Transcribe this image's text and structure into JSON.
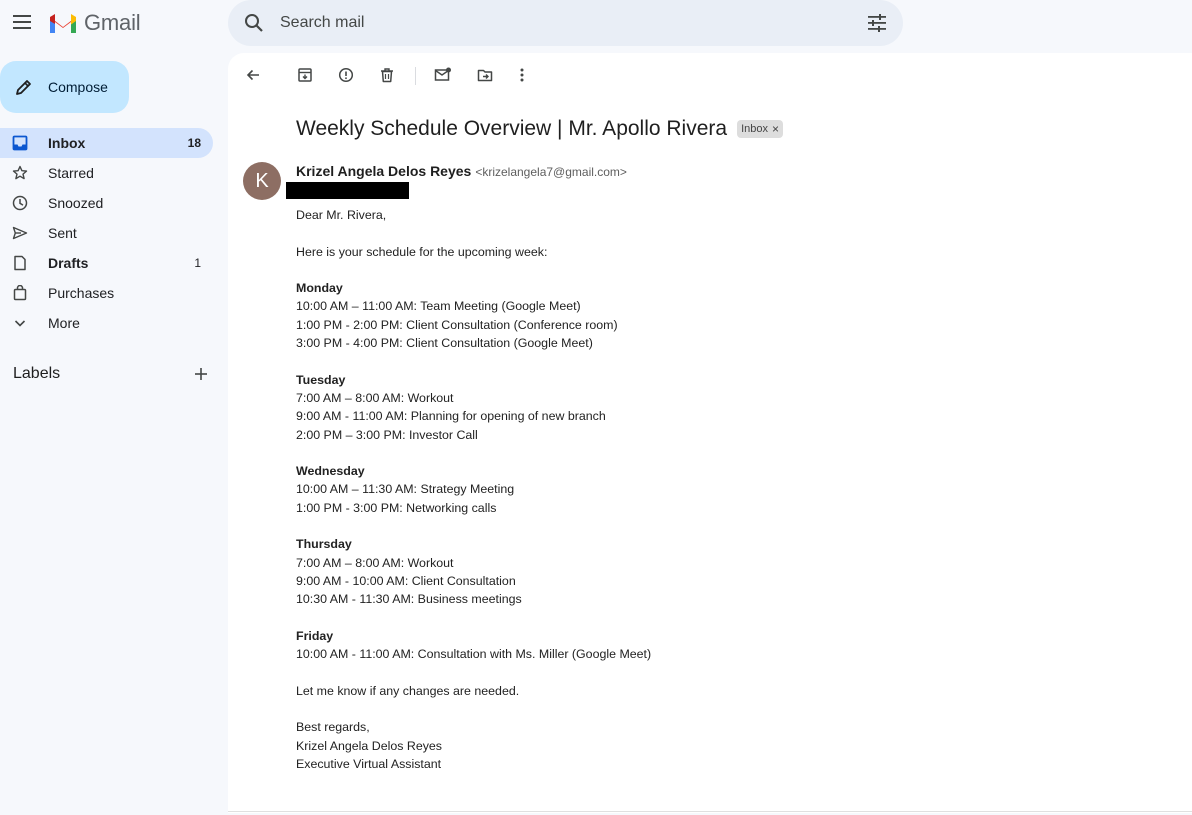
{
  "app": {
    "name": "Gmail"
  },
  "search": {
    "placeholder": "Search mail"
  },
  "compose": {
    "label": "Compose"
  },
  "nav": {
    "items": [
      {
        "label": "Inbox",
        "count": "18"
      },
      {
        "label": "Starred",
        "count": ""
      },
      {
        "label": "Snoozed",
        "count": ""
      },
      {
        "label": "Sent",
        "count": ""
      },
      {
        "label": "Drafts",
        "count": "1"
      },
      {
        "label": "Purchases",
        "count": ""
      },
      {
        "label": "More",
        "count": ""
      }
    ]
  },
  "labels": {
    "title": "Labels"
  },
  "email": {
    "subject": "Weekly Schedule Overview | Mr. Apollo Rivera",
    "label_chip": "Inbox",
    "chip_close": "×",
    "avatar_letter": "K",
    "sender_name": "Krizel Angela Delos Reyes",
    "sender_email": "<krizelangela7@gmail.com>",
    "greeting": "Dear Mr. Rivera,",
    "intro": "Here is your schedule for the upcoming week:",
    "days": [
      {
        "name": "Monday",
        "items": [
          "10:00 AM – 11:00 AM: Team Meeting (Google Meet)",
          "1:00 PM - 2:00 PM: Client Consultation (Conference room)",
          "3:00 PM - 4:00 PM: Client Consultation (Google Meet)"
        ]
      },
      {
        "name": "Tuesday",
        "items": [
          "7:00 AM – 8:00 AM: Workout",
          "9:00 AM - 11:00 AM: Planning for opening of new branch",
          "2:00 PM – 3:00 PM: Investor Call"
        ]
      },
      {
        "name": "Wednesday",
        "items": [
          "10:00 AM – 11:30 AM: Strategy Meeting",
          "1:00 PM - 3:00 PM: Networking calls"
        ]
      },
      {
        "name": "Thursday",
        "items": [
          "7:00 AM – 8:00 AM: Workout",
          "9:00 AM - 10:00 AM: Client Consultation",
          "10:30 AM - 11:30 AM: Business meetings"
        ]
      },
      {
        "name": "Friday",
        "items": [
          "10:00 AM - 11:00 AM: Consultation with Ms. Miller (Google Meet)"
        ]
      }
    ],
    "closing": "Let me know if any changes are needed.",
    "signoff": "Best regards,",
    "signature_name": "Krizel Angela Delos Reyes",
    "signature_title": "Executive Virtual Assistant"
  },
  "icons": {
    "menu": "menu-icon",
    "search": "search-icon",
    "tune": "tune-icon",
    "compose": "pencil-icon",
    "back": "arrow-back-icon",
    "archive": "archive-icon",
    "spam": "report-spam-icon",
    "delete": "trash-icon",
    "mark_unread": "mark-unread-icon",
    "move": "move-to-icon",
    "more": "more-vert-icon"
  },
  "colors": {
    "background": "#f6f8fc",
    "compose": "#c2e7ff",
    "active_nav": "#d3e3fd",
    "avatar": "#8d6e63",
    "search_bg": "#e9eef6"
  }
}
